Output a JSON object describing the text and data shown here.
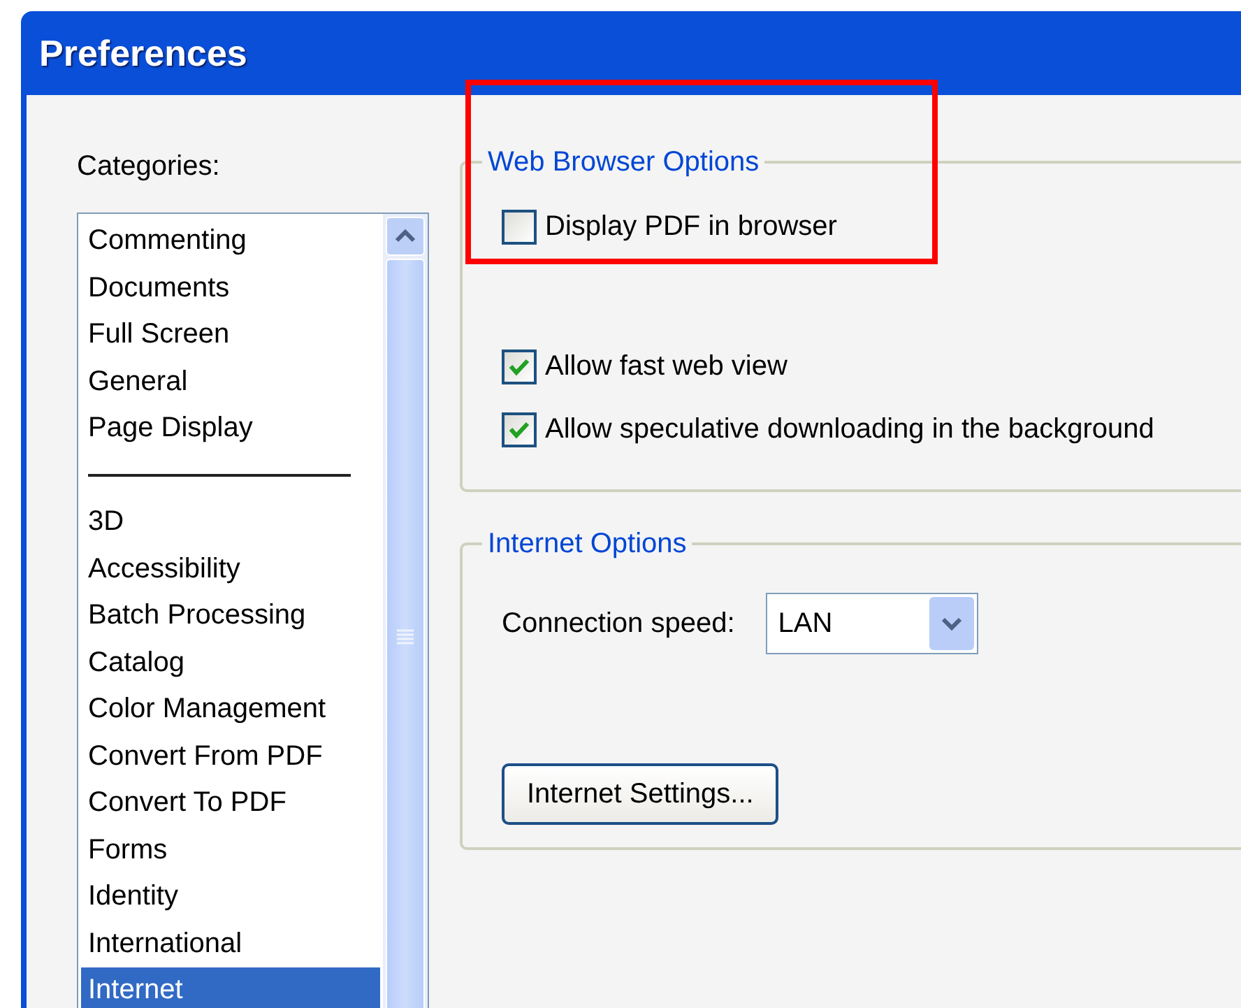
{
  "window": {
    "title": "Preferences"
  },
  "categories": {
    "label": "Categories:",
    "items": [
      {
        "kind": "item",
        "label": "Commenting",
        "selected": false
      },
      {
        "kind": "item",
        "label": "Documents",
        "selected": false
      },
      {
        "kind": "item",
        "label": "Full Screen",
        "selected": false
      },
      {
        "kind": "item",
        "label": "General",
        "selected": false
      },
      {
        "kind": "item",
        "label": "Page Display",
        "selected": false
      },
      {
        "kind": "separator"
      },
      {
        "kind": "item",
        "label": "3D",
        "selected": false
      },
      {
        "kind": "item",
        "label": "Accessibility",
        "selected": false
      },
      {
        "kind": "item",
        "label": "Batch Processing",
        "selected": false
      },
      {
        "kind": "item",
        "label": "Catalog",
        "selected": false
      },
      {
        "kind": "item",
        "label": "Color Management",
        "selected": false
      },
      {
        "kind": "item",
        "label": "Convert From PDF",
        "selected": false
      },
      {
        "kind": "item",
        "label": "Convert To PDF",
        "selected": false
      },
      {
        "kind": "item",
        "label": "Forms",
        "selected": false
      },
      {
        "kind": "item",
        "label": "Identity",
        "selected": false
      },
      {
        "kind": "item",
        "label": "International",
        "selected": false
      },
      {
        "kind": "item",
        "label": "Internet",
        "selected": true
      }
    ]
  },
  "web_browser_options": {
    "title": "Web Browser Options",
    "highlighted": true,
    "checkboxes": [
      {
        "label": "Display PDF in browser",
        "checked": false
      },
      {
        "label": "Allow fast web view",
        "checked": true
      },
      {
        "label": "Allow speculative downloading in the background",
        "checked": true
      }
    ]
  },
  "internet_options": {
    "title": "Internet Options",
    "connection_speed": {
      "label": "Connection speed:",
      "value": "LAN"
    },
    "button": "Internet Settings..."
  }
}
